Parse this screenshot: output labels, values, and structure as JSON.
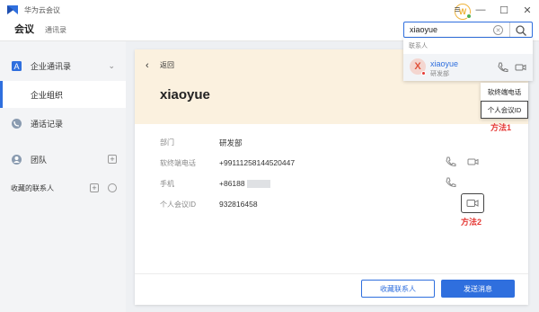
{
  "app": {
    "title": "华为云会议"
  },
  "nav": {
    "tabs": [
      {
        "label": "会议"
      },
      {
        "label": "通讯录"
      }
    ]
  },
  "user_avatar": {
    "initial": "W"
  },
  "search": {
    "value": "xiaoyue"
  },
  "search_dropdown": {
    "section_label": "联系人",
    "result": {
      "avatar_initial": "X",
      "name": "xiaoyue",
      "department": "研发部"
    }
  },
  "sidebar": {
    "items": [
      {
        "label": "企业通讯录",
        "icon": "contacts-book-icon"
      },
      {
        "label": "企业组织"
      },
      {
        "label": "通话记录",
        "icon": "call-history-icon"
      },
      {
        "label": "团队",
        "icon": "team-icon"
      },
      {
        "label": "收藏的联系人"
      }
    ]
  },
  "card": {
    "back_label": "返回",
    "name": "xiaoyue",
    "rows": [
      {
        "label": "部门",
        "value": "研发部"
      },
      {
        "label": "软终端电话",
        "value": "+99111258144520447"
      },
      {
        "label": "手机",
        "value": "+86188"
      },
      {
        "label": "个人会议ID",
        "value": "932816458"
      }
    ],
    "buttons": {
      "favorite": "收藏联系人",
      "send_message": "发送消息"
    }
  },
  "popup_menu": {
    "items": [
      {
        "label": "软终端电话"
      },
      {
        "label": "个人会议ID"
      }
    ]
  },
  "annotations": {
    "method1": "方法1",
    "method2": "方法2"
  },
  "colors": {
    "accent": "#2f6fde",
    "header_bg": "#fbf1df",
    "annotation": "#e53935"
  }
}
